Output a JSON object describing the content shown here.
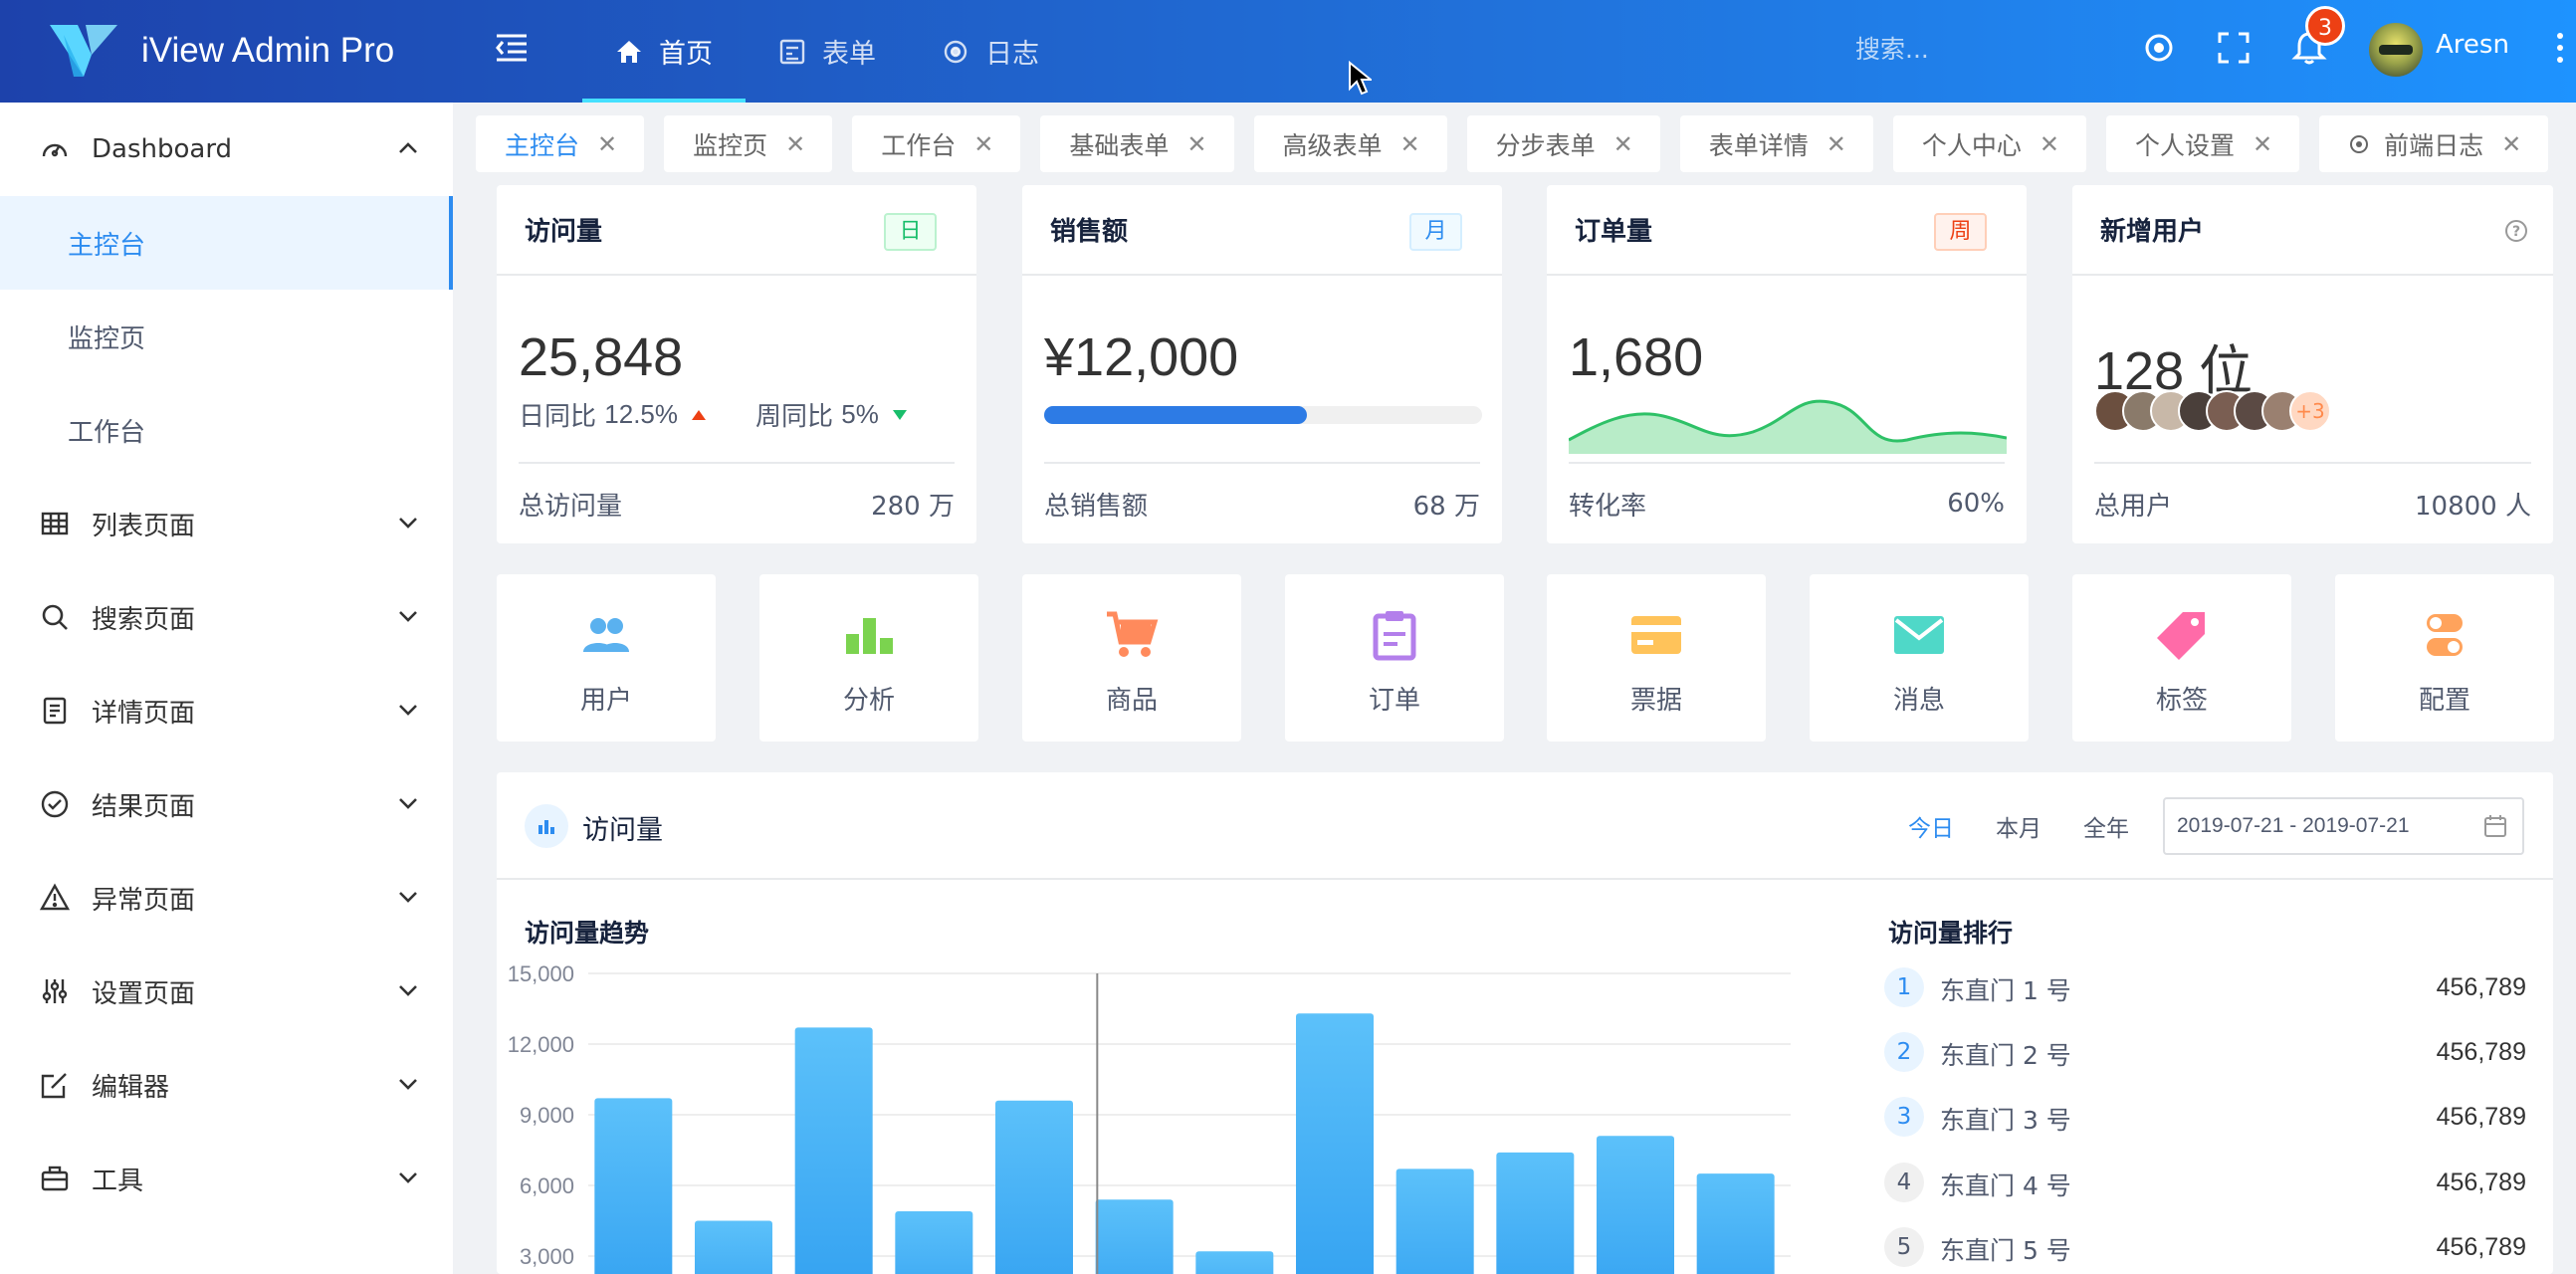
{
  "app": {
    "title": "iView Admin Pro"
  },
  "header": {
    "nav": [
      {
        "label": "首页",
        "icon": "home-icon"
      },
      {
        "label": "表单",
        "icon": "form-icon"
      },
      {
        "label": "日志",
        "icon": "log-icon"
      }
    ],
    "search_placeholder": "搜索...",
    "notification_count": "3",
    "username": "Aresn"
  },
  "sidebar": {
    "groups": [
      {
        "label": "Dashboard",
        "icon": "dashboard-icon",
        "expanded": true,
        "children": [
          "主控台",
          "监控页",
          "工作台"
        ],
        "active_child": "主控台"
      },
      {
        "label": "列表页面",
        "icon": "table-icon"
      },
      {
        "label": "搜索页面",
        "icon": "search-icon"
      },
      {
        "label": "详情页面",
        "icon": "document-icon"
      },
      {
        "label": "结果页面",
        "icon": "check-circle-icon"
      },
      {
        "label": "异常页面",
        "icon": "warning-icon"
      },
      {
        "label": "设置页面",
        "icon": "settings-sliders-icon"
      },
      {
        "label": "编辑器",
        "icon": "edit-icon"
      },
      {
        "label": "工具",
        "icon": "toolbox-icon"
      }
    ]
  },
  "tabs": [
    "主控台",
    "监控页",
    "工作台",
    "基础表单",
    "高级表单",
    "分步表单",
    "表单详情",
    "个人中心",
    "个人设置",
    "前端日志"
  ],
  "stats": {
    "visits": {
      "title": "访问量",
      "tag": "日",
      "value": "25,848",
      "day_cmp_label": "日同比",
      "day_cmp_value": "12.5%",
      "week_cmp_label": "周同比",
      "week_cmp_value": "5%",
      "foot_label": "总访问量",
      "foot_value": "280 万"
    },
    "sales": {
      "title": "销售额",
      "tag": "月",
      "value": "¥12,000",
      "progress": 0.6,
      "foot_label": "总销售额",
      "foot_value": "68 万"
    },
    "orders": {
      "title": "订单量",
      "tag": "周",
      "value": "1,680",
      "foot_label": "转化率",
      "foot_value": "60%"
    },
    "users": {
      "title": "新增用户",
      "value": "128 位",
      "extra_avatars": "+3",
      "foot_label": "总用户",
      "foot_value": "10800 人"
    }
  },
  "quick_entries": [
    {
      "label": "用户",
      "icon": "users-icon",
      "color": "#5ab1ef"
    },
    {
      "label": "分析",
      "icon": "bar-chart-icon",
      "color": "#7bd34f"
    },
    {
      "label": "商品",
      "icon": "cart-icon",
      "color": "#ff8a5c"
    },
    {
      "label": "订单",
      "icon": "clipboard-icon",
      "color": "#b37feb"
    },
    {
      "label": "票据",
      "icon": "card-icon",
      "color": "#ffc35a"
    },
    {
      "label": "消息",
      "icon": "mail-icon",
      "color": "#4fd8c8"
    },
    {
      "label": "标签",
      "icon": "tag-icon",
      "color": "#ff6ba8"
    },
    {
      "label": "配置",
      "icon": "toggle-icon",
      "color": "#ffa35c"
    }
  ],
  "visits_panel": {
    "title": "访问量",
    "ranges": [
      "今日",
      "本月",
      "全年"
    ],
    "active_range": "今日",
    "date_range": "2019-07-21 - 2019-07-21",
    "trend_title": "访问量趋势",
    "rank_title": "访问量排行",
    "ranking": [
      {
        "no": "1",
        "name": "东直门 1 号",
        "value": "456,789"
      },
      {
        "no": "2",
        "name": "东直门 2 号",
        "value": "456,789"
      },
      {
        "no": "3",
        "name": "东直门 3 号",
        "value": "456,789"
      },
      {
        "no": "4",
        "name": "东直门 4 号",
        "value": "456,789"
      },
      {
        "no": "5",
        "name": "东直门 5 号",
        "value": "456,789"
      }
    ]
  },
  "chart_data": {
    "type": "bar",
    "title": "访问量趋势",
    "y_ticks": [
      "15,000",
      "12,000",
      "9,000",
      "6,000",
      "3,000"
    ],
    "ylim": [
      0,
      15000
    ],
    "values": [
      9700,
      4500,
      12700,
      4900,
      9600,
      5400,
      3200,
      13300,
      6700,
      7400,
      8100,
      6500
    ],
    "color": "#4db3f7"
  }
}
